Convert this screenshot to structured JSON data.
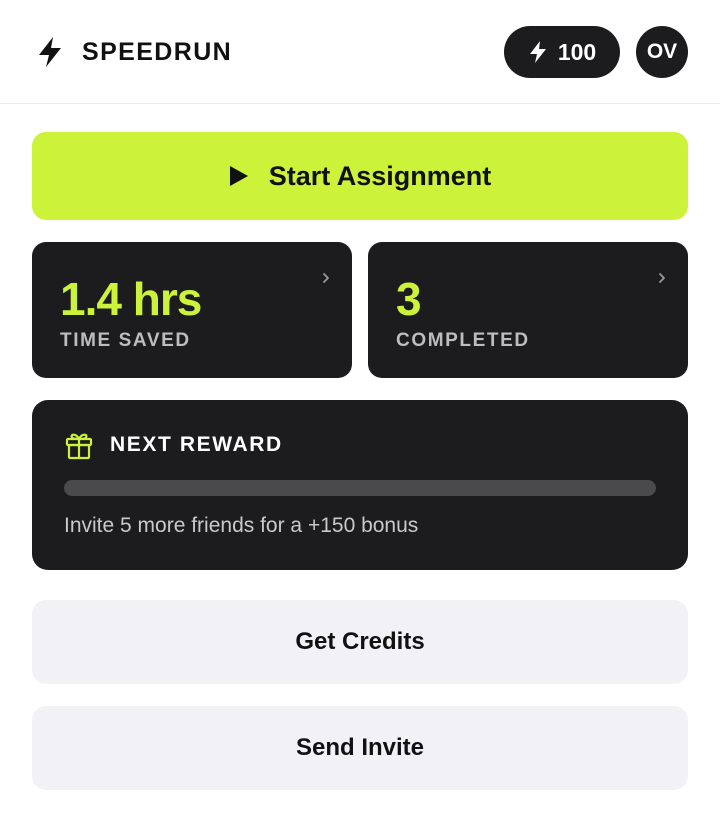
{
  "header": {
    "brand_name": "SPEEDRUN",
    "brand_icon": "bolt-icon",
    "credits_count": "100",
    "avatar_initials": "OV"
  },
  "start": {
    "label": "Start Assignment",
    "icon": "play-icon"
  },
  "stats": [
    {
      "value": "1.4 hrs",
      "label": "TIME SAVED"
    },
    {
      "value": "3",
      "label": "COMPLETED"
    }
  ],
  "reward": {
    "title": "NEXT REWARD",
    "icon": "gift-icon",
    "progress": 0,
    "description": "Invite 5 more friends for a +150 bonus"
  },
  "actions": {
    "get_credits": "Get Credits",
    "send_invite": "Send Invite"
  },
  "colors": {
    "accent": "#ccf33a",
    "dark_card": "#1c1c1e",
    "light_button": "#f2f2f6",
    "track": "#4a4a4c"
  }
}
